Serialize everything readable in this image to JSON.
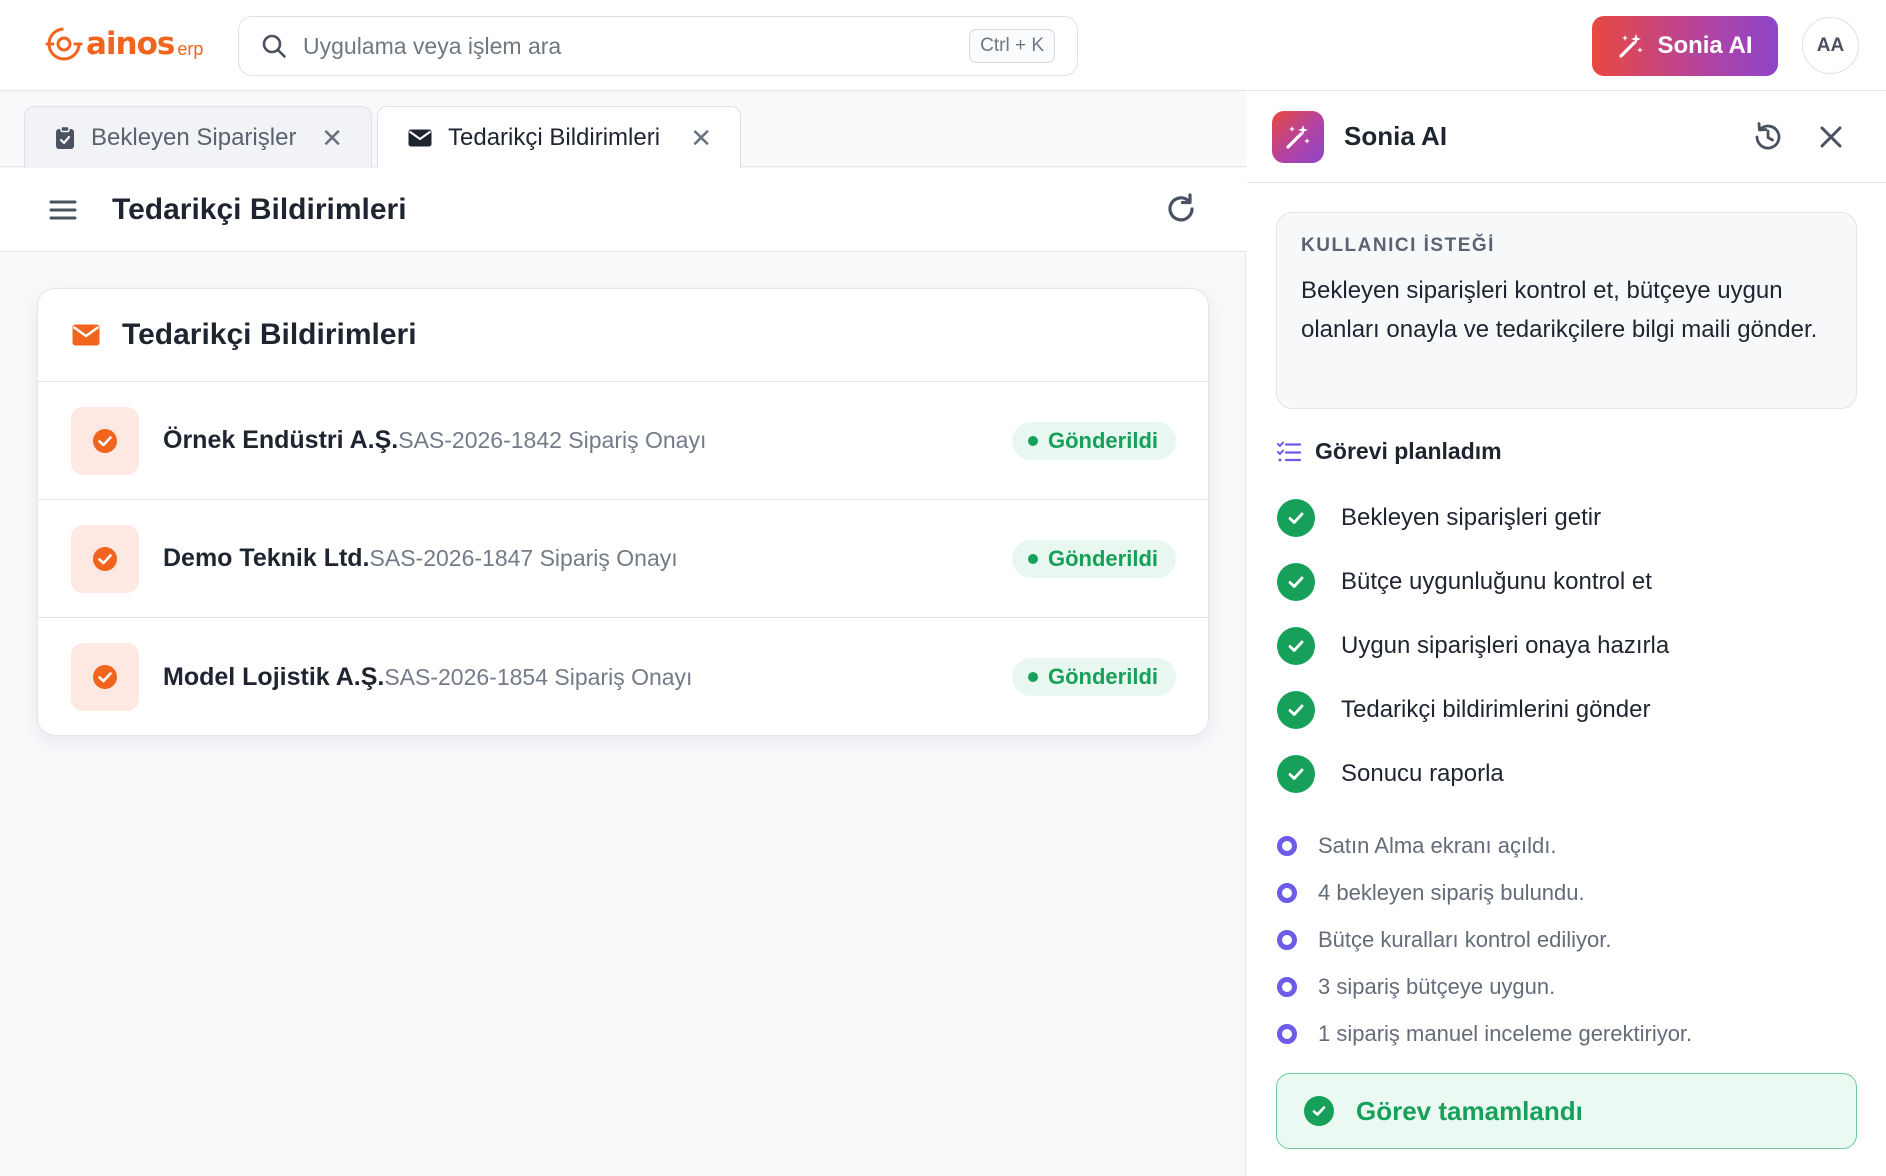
{
  "app": {
    "logo_text": "ainos",
    "logo_sub": "erp",
    "search_placeholder": "Uygulama veya işlem ara",
    "search_shortcut": "Ctrl + K",
    "ai_button_label": "Sonia AI",
    "user_initials": "AA"
  },
  "tabs": [
    {
      "label": "Bekleyen Siparişler",
      "icon": "clipboard-icon",
      "active": false,
      "close": "✕"
    },
    {
      "label": "Tedarikçi Bildirimleri",
      "icon": "envelope-icon",
      "active": true,
      "close": "✕"
    }
  ],
  "page": {
    "title": "Tedarikçi Bildirimleri",
    "card_title": "Tedarikçi Bildirimleri",
    "rows": [
      {
        "name": "Örnek Endüstri A.Ş.",
        "desc": "SAS-2026-1842 Sipariş Onayı",
        "status": "Gönderildi"
      },
      {
        "name": "Demo Teknik Ltd.",
        "desc": "SAS-2026-1847 Sipariş Onayı",
        "status": "Gönderildi"
      },
      {
        "name": "Model Lojistik A.Ş.",
        "desc": "SAS-2026-1854 Sipariş Onayı",
        "status": "Gönderildi"
      }
    ]
  },
  "panel": {
    "title": "Sonia AI",
    "request_label": "KULLANICI İSTEĞİ",
    "request_text": "Bekleyen siparişleri kontrol et, bütçeye uygun olanları onayla ve tedarikçilere bilgi maili gönder.",
    "plan_title": "Görevi planladım",
    "steps": [
      "Bekleyen siparişleri getir",
      "Bütçe uygunluğunu kontrol et",
      "Uygun siparişleri onaya hazırla",
      "Tedarikçi bildirimlerini gönder",
      "Sonucu raporla"
    ],
    "logs": [
      "Satın Alma ekranı açıldı.",
      "4 bekleyen sipariş bulundu.",
      "Bütçe kuralları kontrol ediliyor.",
      "3 sipariş bütçeye uygun.",
      "1 sipariş manuel inceleme gerektiriyor."
    ],
    "done_label": "Görev tamamlandı"
  },
  "colors": {
    "brand": "#f0641e",
    "success": "#17a05a",
    "log_dot": "#6c5ce7",
    "ai_gradient_start": "#e8493f",
    "ai_gradient_end": "#8c45c9"
  }
}
